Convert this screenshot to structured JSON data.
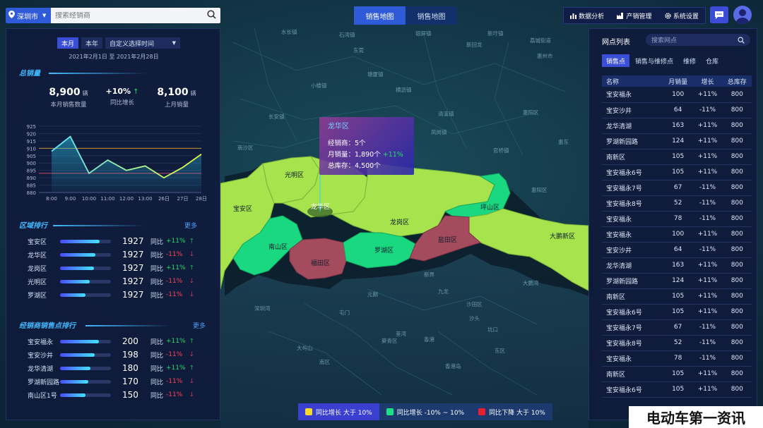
{
  "header": {
    "city": "深圳市",
    "search_placeholder": "搜索经销商",
    "map_tabs": [
      "销售地图",
      "销售地图"
    ],
    "nav": [
      "数据分析",
      "产销管理",
      "系统设置"
    ]
  },
  "left": {
    "period_buttons": [
      "本月",
      "本年"
    ],
    "period_select": "自定义选择时间",
    "date_range": "2021年2月1日 至 2021年2月28日",
    "total_title": "总销量",
    "kpis": [
      {
        "value": "8,900",
        "unit": "辆",
        "label": "本月销售数量"
      },
      {
        "value": "+10%",
        "unit": "↑",
        "label": "同比增长"
      },
      {
        "value": "8,100",
        "unit": "辆",
        "label": "上月销量"
      }
    ],
    "region_title": "区域排行",
    "region_more": "更多",
    "region_rank": [
      {
        "name": "宝安区",
        "value": "1927",
        "tl": "同比",
        "pct": "+11%",
        "dir": "up",
        "fill": 0.78
      },
      {
        "name": "龙华区",
        "value": "1927",
        "tl": "同比",
        "pct": "-11%",
        "dir": "down",
        "fill": 0.7
      },
      {
        "name": "龙岗区",
        "value": "1927",
        "tl": "同比",
        "pct": "+11%",
        "dir": "up",
        "fill": 0.66
      },
      {
        "name": "光明区",
        "value": "1927",
        "tl": "同比",
        "pct": "-11%",
        "dir": "down",
        "fill": 0.58
      },
      {
        "name": "罗湖区",
        "value": "1927",
        "tl": "同比",
        "pct": "-11%",
        "dir": "down",
        "fill": 0.5
      }
    ],
    "dealer_title": "经销商销售点排行",
    "dealer_more": "更多",
    "dealer_rank": [
      {
        "name": "宝安福永",
        "value": "200",
        "tl": "同比",
        "pct": "+11%",
        "dir": "up",
        "fill": 0.76
      },
      {
        "name": "宝安沙井",
        "value": "198",
        "tl": "同比",
        "pct": "-11%",
        "dir": "down",
        "fill": 0.68
      },
      {
        "name": "龙华清湖",
        "value": "180",
        "tl": "同比",
        "pct": "+11%",
        "dir": "up",
        "fill": 0.6
      },
      {
        "name": "罗湖新园路",
        "value": "170",
        "tl": "同比",
        "pct": "-11%",
        "dir": "down",
        "fill": 0.56
      },
      {
        "name": "南山区1号",
        "value": "150",
        "tl": "同比",
        "pct": "-11%",
        "dir": "down",
        "fill": 0.5
      }
    ]
  },
  "chart_data": {
    "type": "line",
    "categories": [
      "8:00",
      "9:00",
      "10:00",
      "11:00",
      "12:00",
      "13:00",
      "26日",
      "27日",
      "28日"
    ],
    "values": [
      908,
      918,
      893,
      902,
      895,
      898,
      890,
      897,
      906
    ],
    "ylim": [
      880,
      925
    ],
    "yticks": [
      880,
      885,
      890,
      895,
      900,
      905,
      910,
      915,
      920,
      925
    ],
    "reference_lines": [
      {
        "value": 910,
        "color": "#e6a531"
      },
      {
        "value": 893,
        "color": "#e04c6a"
      }
    ],
    "grid": true,
    "line_color_start": "#5fe3ff",
    "line_color_end": "#e8ff40"
  },
  "map": {
    "tooltip": {
      "title": "龙华区",
      "dealers_label": "经销商：",
      "dealers": "5个",
      "monthly_label": "月销量：",
      "monthly": "1,890个",
      "monthly_pct": "+11%",
      "stock_label": "总库存：",
      "stock": "4,500个"
    },
    "districts": [
      "光明区",
      "宝安区",
      "龙华区",
      "龙岗区",
      "坪山区",
      "南山区",
      "福田区",
      "罗湖区",
      "盐田区",
      "大鹏新区"
    ],
    "place_labels": [
      "水长镇",
      "石湾镇",
      "银屏镇",
      "新圩镇",
      "荔城街道",
      "小楼镇",
      "横沥镇",
      "惠州市",
      "惠阳区",
      "惠东",
      "清溪镇",
      "凤岗镇",
      "塘厦镇",
      "东莞",
      "长安镇",
      "新回龙",
      "官桥镇",
      "南沙区",
      "沙田区",
      "香港",
      "元朗",
      "屯门",
      "九龙",
      "荃湾",
      "沙头",
      "香港岛",
      "葵青区",
      "新界",
      "大屿山",
      "南区",
      "东区",
      "坑口",
      "深圳湾",
      "大鹏湾",
      "惠阳区"
    ],
    "legend": [
      "同比增长 大于 10%",
      "同比增长 -10% ~ 10%",
      "同比下降 大于 10%"
    ],
    "legend_colors": [
      "#f5d92c",
      "#18e287",
      "#e81f2d"
    ],
    "colors": {
      "lime": "#a6e34c",
      "green": "#19d87f",
      "red": "#a54b5e"
    }
  },
  "right": {
    "title": "网点列表",
    "search_placeholder": "搜索网点",
    "tabs": [
      "销售点",
      "销售与维修点",
      "维修",
      "仓库"
    ],
    "columns": [
      "名称",
      "月销量",
      "增长",
      "总库存"
    ],
    "rows": [
      [
        "宝安福永",
        "100",
        "+11%",
        "800",
        "up"
      ],
      [
        "宝安沙井",
        "64",
        "-11%",
        "800",
        "down"
      ],
      [
        "龙华清湖",
        "163",
        "+11%",
        "800",
        "up"
      ],
      [
        "罗湖新园路",
        "124",
        "+11%",
        "800",
        "up"
      ],
      [
        "南新区",
        "105",
        "+11%",
        "800",
        "up"
      ],
      [
        "宝安福永6号",
        "105",
        "+11%",
        "800",
        "up"
      ],
      [
        "宝安福永7号",
        "67",
        "-11%",
        "800",
        "down"
      ],
      [
        "宝安福永8号",
        "52",
        "-11%",
        "800",
        "down"
      ],
      [
        "宝安福永",
        "78",
        "-11%",
        "800",
        "down"
      ],
      [
        "宝安福永",
        "100",
        "+11%",
        "800",
        "up"
      ],
      [
        "宝安沙井",
        "64",
        "-11%",
        "800",
        "down"
      ],
      [
        "龙华清湖",
        "163",
        "+11%",
        "800",
        "up"
      ],
      [
        "罗湖新园路",
        "124",
        "+11%",
        "800",
        "up"
      ],
      [
        "南新区",
        "105",
        "+11%",
        "800",
        "up"
      ],
      [
        "宝安福永6号",
        "105",
        "+11%",
        "800",
        "up"
      ],
      [
        "宝安福永7号",
        "67",
        "-11%",
        "800",
        "down"
      ],
      [
        "宝安福永8号",
        "52",
        "-11%",
        "800",
        "down"
      ],
      [
        "宝安福永",
        "78",
        "-11%",
        "800",
        "down"
      ],
      [
        "南新区",
        "105",
        "+11%",
        "800",
        "up"
      ],
      [
        "宝安福永6号",
        "105",
        "+11%",
        "800",
        "up"
      ]
    ]
  },
  "watermark": "电动车第一资讯"
}
